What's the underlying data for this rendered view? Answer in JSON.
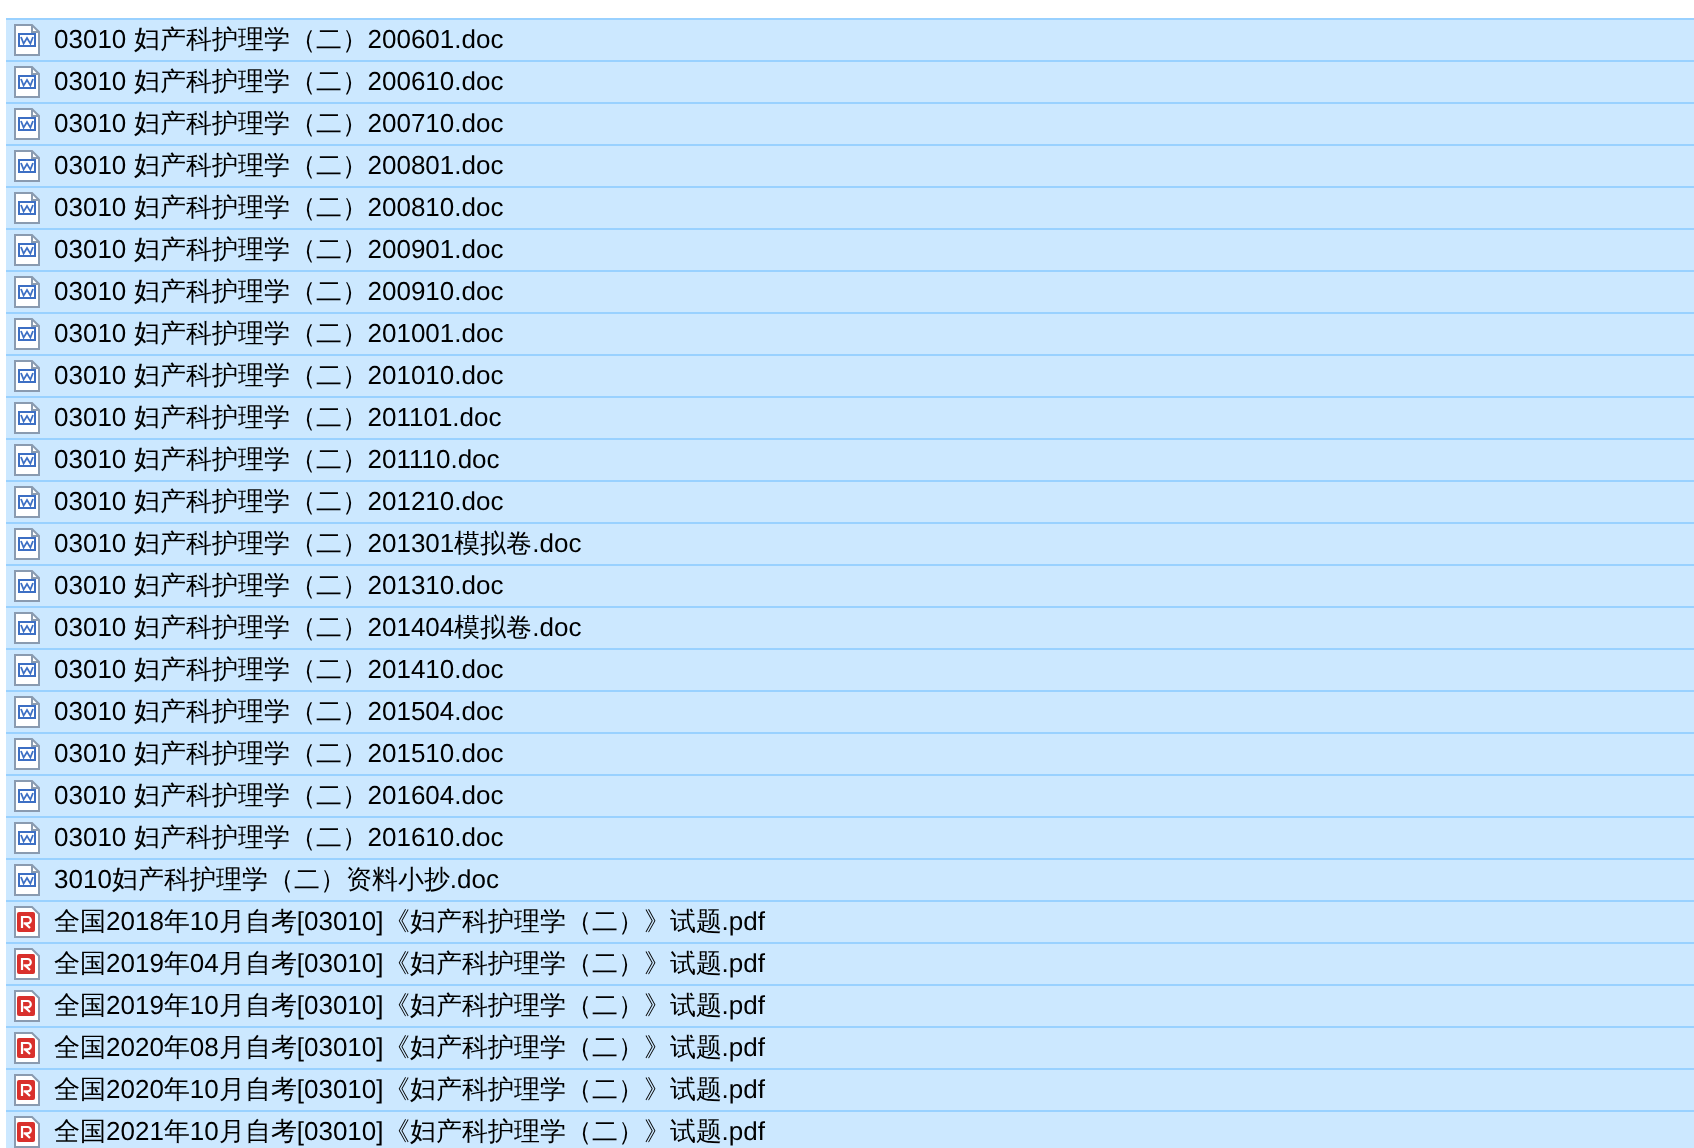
{
  "files": [
    {
      "name": "03010 妇产科护理学（二）200601.doc",
      "kind": "doc",
      "selected": true
    },
    {
      "name": "03010 妇产科护理学（二）200610.doc",
      "kind": "doc",
      "selected": true
    },
    {
      "name": "03010 妇产科护理学（二）200710.doc",
      "kind": "doc",
      "selected": true
    },
    {
      "name": "03010 妇产科护理学（二）200801.doc",
      "kind": "doc",
      "selected": true
    },
    {
      "name": "03010 妇产科护理学（二）200810.doc",
      "kind": "doc",
      "selected": true
    },
    {
      "name": "03010 妇产科护理学（二）200901.doc",
      "kind": "doc",
      "selected": true
    },
    {
      "name": "03010 妇产科护理学（二）200910.doc",
      "kind": "doc",
      "selected": true
    },
    {
      "name": "03010 妇产科护理学（二）201001.doc",
      "kind": "doc",
      "selected": true
    },
    {
      "name": "03010 妇产科护理学（二）201010.doc",
      "kind": "doc",
      "selected": true
    },
    {
      "name": "03010 妇产科护理学（二）201101.doc",
      "kind": "doc",
      "selected": true
    },
    {
      "name": "03010 妇产科护理学（二）201110.doc",
      "kind": "doc",
      "selected": true
    },
    {
      "name": "03010 妇产科护理学（二）201210.doc",
      "kind": "doc",
      "selected": true
    },
    {
      "name": "03010 妇产科护理学（二）201301模拟卷.doc",
      "kind": "doc",
      "selected": true
    },
    {
      "name": "03010 妇产科护理学（二）201310.doc",
      "kind": "doc",
      "selected": true
    },
    {
      "name": "03010 妇产科护理学（二）201404模拟卷.doc",
      "kind": "doc",
      "selected": true
    },
    {
      "name": "03010 妇产科护理学（二）201410.doc",
      "kind": "doc",
      "selected": true
    },
    {
      "name": "03010 妇产科护理学（二）201504.doc",
      "kind": "doc",
      "selected": true
    },
    {
      "name": "03010 妇产科护理学（二）201510.doc",
      "kind": "doc",
      "selected": true
    },
    {
      "name": "03010 妇产科护理学（二）201604.doc",
      "kind": "doc",
      "selected": true
    },
    {
      "name": "03010 妇产科护理学（二）201610.doc",
      "kind": "doc",
      "selected": true
    },
    {
      "name": "3010妇产科护理学（二）资料小抄.doc",
      "kind": "doc",
      "selected": true
    },
    {
      "name": "全国2018年10月自考[03010]《妇产科护理学（二）》试题.pdf",
      "kind": "pdf",
      "selected": true
    },
    {
      "name": "全国2019年04月自考[03010]《妇产科护理学（二）》试题.pdf",
      "kind": "pdf",
      "selected": true
    },
    {
      "name": "全国2019年10月自考[03010]《妇产科护理学（二）》试题.pdf",
      "kind": "pdf",
      "selected": true
    },
    {
      "name": "全国2020年08月自考[03010]《妇产科护理学（二）》试题.pdf",
      "kind": "pdf",
      "selected": true
    },
    {
      "name": "全国2020年10月自考[03010]《妇产科护理学（二）》试题.pdf",
      "kind": "pdf",
      "selected": true
    },
    {
      "name": "全国2021年10月自考[03010]《妇产科护理学（二）》试题.pdf",
      "kind": "pdf",
      "selected": true
    }
  ]
}
